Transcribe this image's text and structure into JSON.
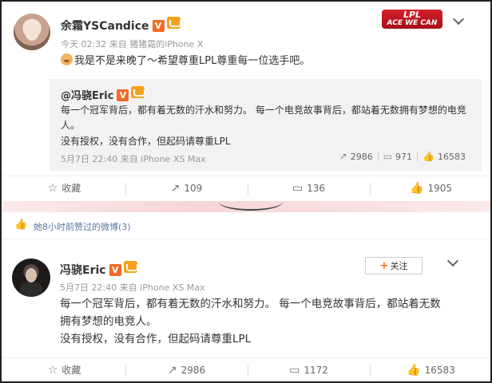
{
  "post1": {
    "username": "余霜YSCandice",
    "badge_v": "V",
    "meta": "今天 02:32 来自 猪猪霜的iPhone X",
    "text": "我是不是来晚了～希望尊重LPL尊重每一位选手吧。",
    "logo_line1": "LPL",
    "logo_line2": "ACE WE CAN",
    "repost": {
      "username": "@冯骁Eric",
      "badge_v": "V",
      "text1": "每一个冠军背后，都有着无数的汗水和努力。 每一个电竞故事背后，都站着无数拥有梦想的电竞人。",
      "text2": "没有授权，没有合作，但起码请尊重LPL",
      "meta": "5月7日 22:40 来自 iPhone XS Max",
      "reposts": "2986",
      "comments": "971",
      "likes": "16583"
    },
    "actions": {
      "favorite": "收藏",
      "repost": "109",
      "comment": "136",
      "like": "1905"
    }
  },
  "liked_notice": "她8小时前赞过的微博(3)",
  "post2": {
    "username": "冯骁Eric",
    "badge_v": "V",
    "meta": "5月7日 22:40 来自 iPhone XS Max",
    "follow_label": "关注",
    "text1": "每一个冠军背后，都有着无数的汗水和努力。 每一个电竞故事背后，都站着无数",
    "text2": "拥有梦想的电竞人。",
    "text3": "没有授权，没有合作，但起码请尊重LPL",
    "actions": {
      "favorite": "收藏",
      "repost": "2986",
      "comment": "1172",
      "like": "16583"
    }
  },
  "icons": {
    "star": "☆",
    "repost": "↗",
    "comment": "▭",
    "like": "👍"
  },
  "colors": {
    "accent": "#f26b24",
    "link": "#5a7aa6",
    "muted": "#999999"
  }
}
